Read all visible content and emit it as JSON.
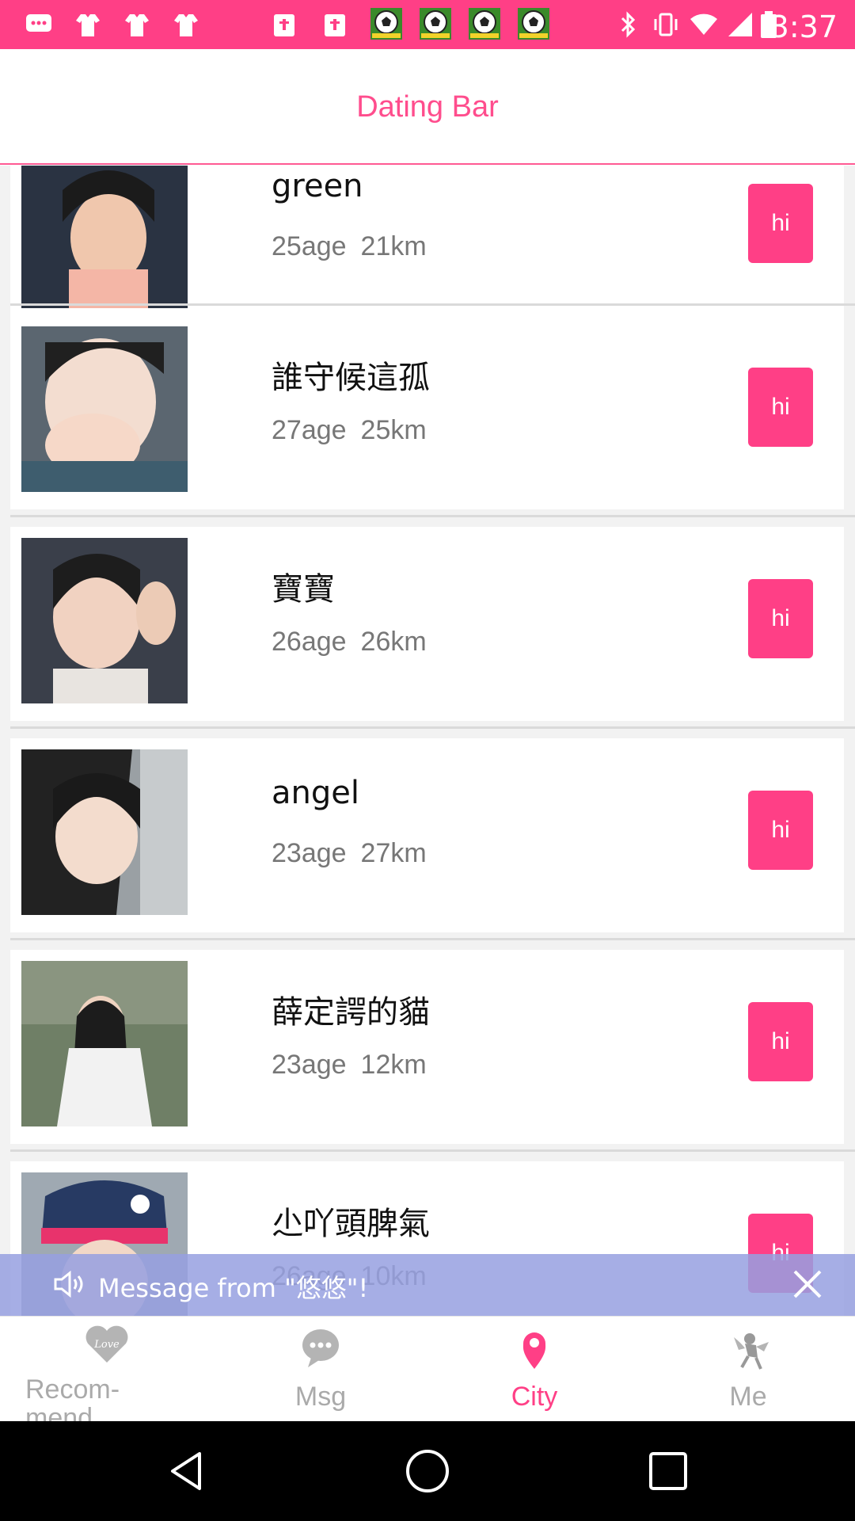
{
  "status_bar": {
    "time": "3:37",
    "icons": [
      "chat-icon",
      "shirt-icon",
      "shirt-icon",
      "shirt-icon",
      "calendar-icon",
      "calendar-icon",
      "soccer-ball-icon",
      "soccer-ball-icon",
      "soccer-ball-icon",
      "soccer-ball-icon",
      "bluetooth-icon",
      "vibrate-icon",
      "wifi-icon",
      "signal-icon",
      "battery-icon"
    ]
  },
  "header": {
    "title": "Dating Bar"
  },
  "profiles": [
    {
      "name": "green",
      "age": "25age",
      "distance": "21km",
      "button": "hi"
    },
    {
      "name": "誰守候這孤",
      "age": "27age",
      "distance": "25km",
      "button": "hi"
    },
    {
      "name": "寶寶",
      "age": "26age",
      "distance": "26km",
      "button": "hi"
    },
    {
      "name": "angel",
      "age": "23age",
      "distance": "27km",
      "button": "hi"
    },
    {
      "name": "薛定諤的貓",
      "age": "23age",
      "distance": "12km",
      "button": "hi"
    },
    {
      "name": "尐吖頭脾氣",
      "age": "26age",
      "distance": "10km",
      "button": "hi"
    }
  ],
  "toast": {
    "message": "Message from \"悠悠\"!"
  },
  "bottom_nav": {
    "items": [
      {
        "label": "Recom-\nmend",
        "icon": "heart-love-icon",
        "active": false
      },
      {
        "label": "Msg",
        "icon": "chat-bubble-icon",
        "active": false
      },
      {
        "label": "City",
        "icon": "location-pin-icon",
        "active": true
      },
      {
        "label": "Me",
        "icon": "cupid-icon",
        "active": false
      }
    ]
  },
  "colors": {
    "accent": "#ff3f86",
    "inactive": "#aaaaaa",
    "toast": "#96a0e1"
  }
}
